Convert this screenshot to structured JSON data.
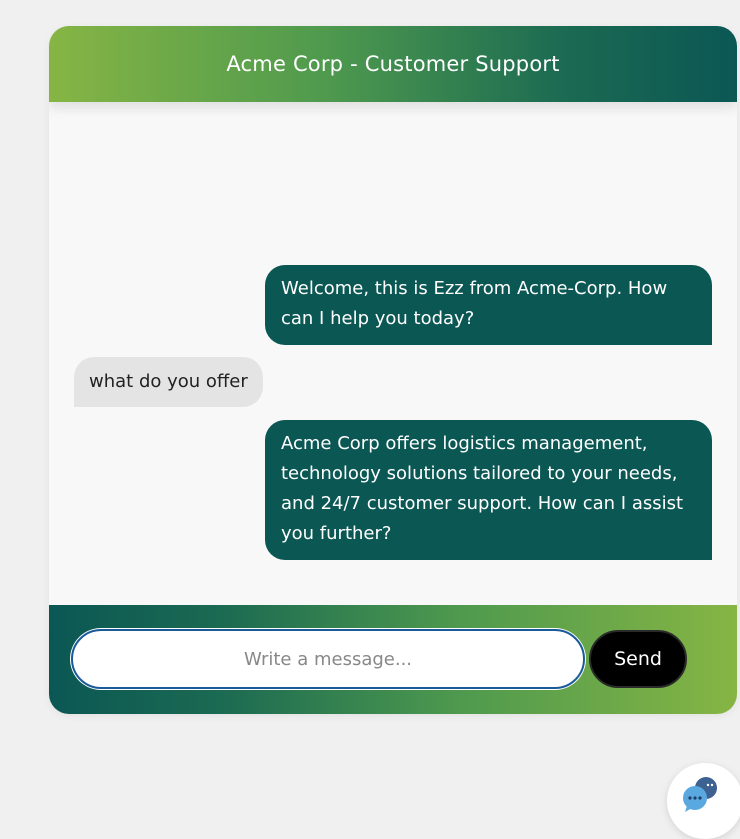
{
  "header": {
    "title": "Acme Corp - Customer Support"
  },
  "messages": [
    {
      "sender": "bot",
      "text": "Welcome, this is Ezz from Acme-Corp. How can I help you today?"
    },
    {
      "sender": "user",
      "text": "what do you offer"
    },
    {
      "sender": "bot",
      "text": "Acme Corp offers logistics management, technology solutions tailored to your needs, and 24/7 customer support. How can I assist you further?"
    }
  ],
  "composer": {
    "placeholder": "Write a message...",
    "value": "",
    "send_label": "Send"
  },
  "launcher": {
    "icon": "chat-bubbles-icon"
  },
  "colors": {
    "bot_bubble": "#0b5754",
    "user_bubble": "#e4e4e4",
    "accent_green": "#86b544",
    "send_button": "#000000"
  }
}
